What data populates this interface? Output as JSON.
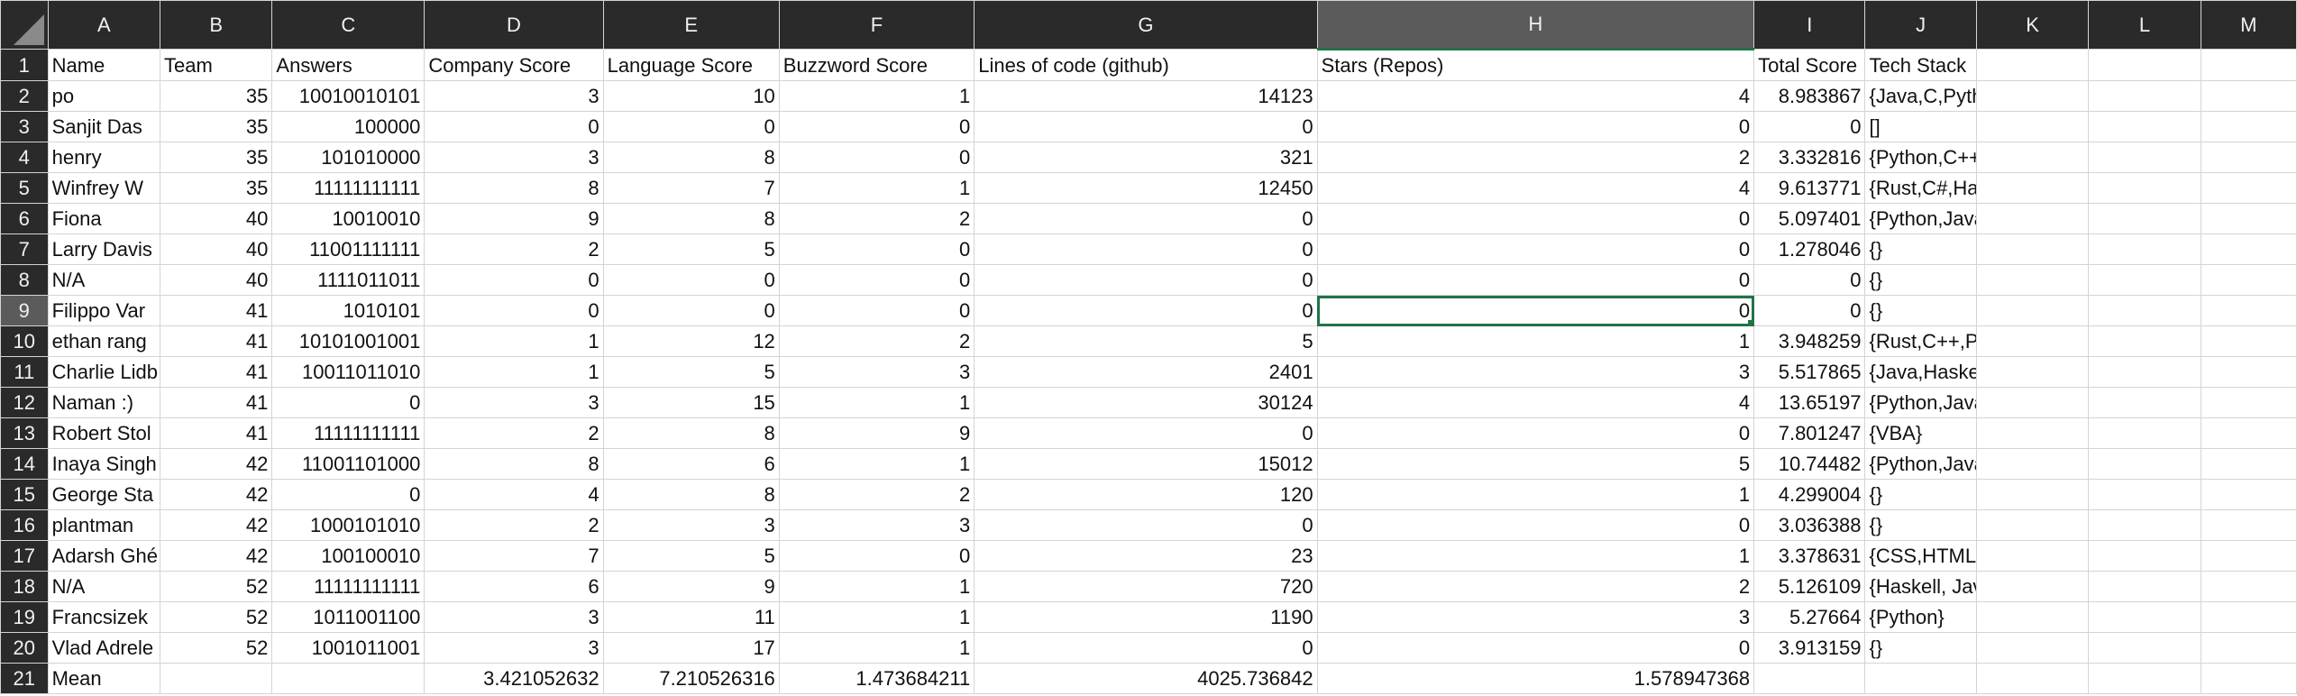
{
  "columns": [
    "A",
    "B",
    "C",
    "D",
    "E",
    "F",
    "G",
    "H",
    "I",
    "J",
    "K",
    "L",
    "M"
  ],
  "selected": {
    "column": "H",
    "row": "9"
  },
  "accent_color": "#217346",
  "rows": [
    {
      "num": "1",
      "cells": [
        "Name",
        "Team",
        "Answers",
        "Company Score",
        "Language Score",
        "Buzzword Score",
        "Lines of code (github)",
        "Stars (Repos)",
        "Total Score",
        "Tech Stack",
        "",
        "",
        ""
      ]
    },
    {
      "num": "2",
      "cells": [
        "po",
        "35",
        "10010010101",
        "3",
        "10",
        "1",
        "14123",
        "4",
        "8.983867",
        "{Java,C,Python,SQL}",
        "",
        "",
        ""
      ]
    },
    {
      "num": "3",
      "cells": [
        "Sanjit Das",
        "35",
        "100000",
        "0",
        "0",
        "0",
        "0",
        "0",
        "0",
        "[]",
        "",
        "",
        ""
      ]
    },
    {
      "num": "4",
      "cells": [
        "henry",
        "35",
        "101010000",
        "3",
        "8",
        "0",
        "321",
        "2",
        "3.332816",
        "{Python,C++,Scala,VBA,Java,Haskell,SQL,Kotlin}",
        "",
        "",
        ""
      ]
    },
    {
      "num": "5",
      "cells": [
        "Winfrey W",
        "35",
        "11111111111",
        "8",
        "7",
        "1",
        "12450",
        "4",
        "9.613771",
        "{Rust,C#,Haskell,Java,Kotlin}",
        "",
        "",
        ""
      ]
    },
    {
      "num": "6",
      "cells": [
        "Fiona",
        "40",
        "10010010",
        "9",
        "8",
        "2",
        "0",
        "0",
        "5.097401",
        "{Python,Java,Haskell}",
        "",
        "",
        ""
      ]
    },
    {
      "num": "7",
      "cells": [
        "Larry Davis",
        "40",
        "11001111111",
        "2",
        "5",
        "0",
        "0",
        "0",
        "1.278046",
        "{}",
        "",
        "",
        ""
      ]
    },
    {
      "num": "8",
      "cells": [
        "N/A",
        "40",
        "1111011011",
        "0",
        "0",
        "0",
        "0",
        "0",
        "0",
        "{}",
        "",
        "",
        ""
      ]
    },
    {
      "num": "9",
      "cells": [
        "Filippo Var",
        "41",
        "1010101",
        "0",
        "0",
        "0",
        "0",
        "0",
        "0",
        "{}",
        "",
        "",
        ""
      ]
    },
    {
      "num": "10",
      "cells": [
        "ethan rang",
        "41",
        "10101001001",
        "1",
        "12",
        "2",
        "5",
        "1",
        "3.948259",
        "{Rust,C++,Python}",
        "",
        "",
        ""
      ]
    },
    {
      "num": "11",
      "cells": [
        "Charlie Lidb",
        "41",
        "10011011010",
        "1",
        "5",
        "3",
        "2401",
        "3",
        "5.517865",
        "{Java,Haskel,SQL,Python}",
        "",
        "",
        ""
      ]
    },
    {
      "num": "12",
      "cells": [
        "Naman :)",
        "41",
        "0",
        "3",
        "15",
        "1",
        "30124",
        "4",
        "13.65197",
        "{Python,Java,Haskell}",
        "",
        "",
        ""
      ]
    },
    {
      "num": "13",
      "cells": [
        "Robert Stol",
        "41",
        "11111111111",
        "2",
        "8",
        "9",
        "0",
        "0",
        "7.801247",
        "{VBA}",
        "",
        "",
        ""
      ]
    },
    {
      "num": "14",
      "cells": [
        "Inaya Singh",
        "42",
        "11001101000",
        "8",
        "6",
        "1",
        "15012",
        "5",
        "10.74482",
        "{Python,Java Script}",
        "",
        "",
        ""
      ]
    },
    {
      "num": "15",
      "cells": [
        "George Sta",
        "42",
        "0",
        "4",
        "8",
        "2",
        "120",
        "1",
        "4.299004",
        "{}",
        "",
        "",
        ""
      ]
    },
    {
      "num": "16",
      "cells": [
        "plantman",
        "42",
        "1000101010",
        "2",
        "3",
        "3",
        "0",
        "0",
        "3.036388",
        "{}",
        "",
        "",
        ""
      ]
    },
    {
      "num": "17",
      "cells": [
        "Adarsh Ghé",
        "42",
        "100100010",
        "7",
        "5",
        "0",
        "23",
        "1",
        "3.378631",
        "{CSS,HTML,Javascript, Python}",
        "",
        "",
        ""
      ]
    },
    {
      "num": "18",
      "cells": [
        "N/A",
        "52",
        "11111111111",
        "6",
        "9",
        "1",
        "720",
        "2",
        "5.126109",
        "{Haskell, Java, Kotlin}",
        "",
        "",
        ""
      ]
    },
    {
      "num": "19",
      "cells": [
        "Francsizek",
        "52",
        "1011001100",
        "3",
        "11",
        "1",
        "1190",
        "3",
        "5.27664",
        "{Python}",
        "",
        "",
        ""
      ]
    },
    {
      "num": "20",
      "cells": [
        "Vlad Adrele",
        "52",
        "1001011001",
        "3",
        "17",
        "1",
        "0",
        "0",
        "3.913159",
        "{}",
        "",
        "",
        ""
      ]
    },
    {
      "num": "21",
      "cells": [
        "Mean",
        "",
        "",
        "3.421052632",
        "7.210526316",
        "1.473684211",
        "4025.736842",
        "1.578947368",
        "",
        "",
        "",
        "",
        ""
      ]
    }
  ]
}
